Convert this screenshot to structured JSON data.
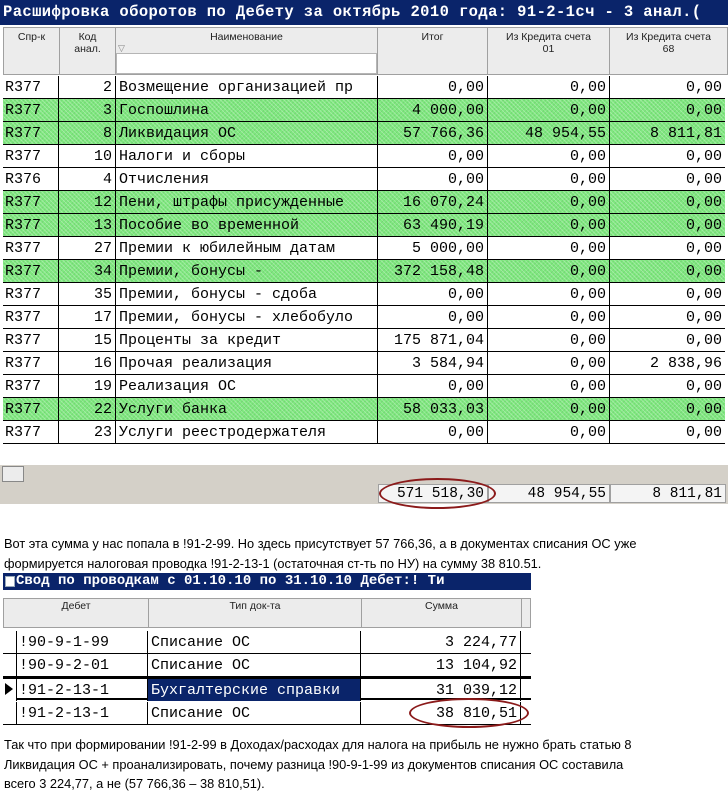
{
  "win1": {
    "title": "Расшифровка оборотов по Дебету за октябрь 2010 года: 91-2-1сч - 3 анал.(",
    "columns": [
      "Спр-к",
      "Код\nанал.",
      "Наименование",
      "Итог",
      "Из Кредита счета\n01",
      "Из Кредита счета\n68"
    ],
    "rows": [
      {
        "sprk": "R377",
        "code": "2",
        "name": "Возмещение организацией пр",
        "total": "0,00",
        "cr01": "0,00",
        "cr68": "0,00",
        "green": false
      },
      {
        "sprk": "R377",
        "code": "3",
        "name": "Госпошлина",
        "total": "4 000,00",
        "cr01": "0,00",
        "cr68": "0,00",
        "green": true
      },
      {
        "sprk": "R377",
        "code": "8",
        "name": "Ликвидация ОС",
        "total": "57 766,36",
        "cr01": "48 954,55",
        "cr68": "8 811,81",
        "green": true
      },
      {
        "sprk": "R377",
        "code": "10",
        "name": "Налоги и сборы",
        "total": "0,00",
        "cr01": "0,00",
        "cr68": "0,00",
        "green": false
      },
      {
        "sprk": "R376",
        "code": "4",
        "name": "Отчисления",
        "total": "0,00",
        "cr01": "0,00",
        "cr68": "0,00",
        "green": false
      },
      {
        "sprk": "R377",
        "code": "12",
        "name": "Пени, штрафы присужденные",
        "total": "16 070,24",
        "cr01": "0,00",
        "cr68": "0,00",
        "green": true
      },
      {
        "sprk": "R377",
        "code": "13",
        "name": "Пособие во временной",
        "total": "63 490,19",
        "cr01": "0,00",
        "cr68": "0,00",
        "green": true
      },
      {
        "sprk": "R377",
        "code": "27",
        "name": "Премии к юбилейным датам",
        "total": "5 000,00",
        "cr01": "0,00",
        "cr68": "0,00",
        "green": false
      },
      {
        "sprk": "R377",
        "code": "34",
        "name": "Премии, бонусы -",
        "total": "372 158,48",
        "cr01": "0,00",
        "cr68": "0,00",
        "green": true
      },
      {
        "sprk": "R377",
        "code": "35",
        "name": "Премии, бонусы - сдоба",
        "total": "0,00",
        "cr01": "0,00",
        "cr68": "0,00",
        "green": false
      },
      {
        "sprk": "R377",
        "code": "17",
        "name": "Премии, бонусы - хлебобуло",
        "total": "0,00",
        "cr01": "0,00",
        "cr68": "0,00",
        "green": false
      },
      {
        "sprk": "R377",
        "code": "15",
        "name": "Проценты за кредит",
        "total": "175 871,04",
        "cr01": "0,00",
        "cr68": "0,00",
        "green": false
      },
      {
        "sprk": "R377",
        "code": "16",
        "name": "Прочая реализация",
        "total": "3 584,94",
        "cr01": "0,00",
        "cr68": "2 838,96",
        "green": false
      },
      {
        "sprk": "R377",
        "code": "19",
        "name": "Реализация ОС",
        "total": "0,00",
        "cr01": "0,00",
        "cr68": "0,00",
        "green": false
      },
      {
        "sprk": "R377",
        "code": "22",
        "name": "Услуги банка",
        "total": "58 033,03",
        "cr01": "0,00",
        "cr68": "0,00",
        "green": true
      },
      {
        "sprk": "R377",
        "code": "23",
        "name": "Услуги реестродержателя",
        "total": "0,00",
        "cr01": "0,00",
        "cr68": "0,00",
        "green": false
      }
    ],
    "footer": {
      "total": "571 518,30",
      "cr01": "48 954,55",
      "cr68": "8 811,81"
    }
  },
  "text1": {
    "line1": "Вот эта сумма у нас попала в !91-2-99. Но здесь присутствует 57 766,36, а в документах списания ОС уже",
    "line2": "формируется налоговая проводка !91-2-13-1 (остаточная ст-ть по НУ) на сумму 38 810.51."
  },
  "win2": {
    "title": "Свод по проводкам с 01.10.10 по 31.10.10 Дебет:! Ти",
    "columns": [
      "Дебет",
      "Тип док-та",
      "Сумма"
    ],
    "rows": [
      {
        "debit": "!90-9-1-99",
        "doctype": "Списание ОС",
        "sum": "3 224,77",
        "selected": false
      },
      {
        "debit": "!90-9-2-01",
        "doctype": "Списание ОС",
        "sum": "13 104,92",
        "selected": false
      },
      {
        "debit": "!91-2-13-1",
        "doctype": "Бухгалтерские справки",
        "sum": "31 039,12",
        "selected": true
      },
      {
        "debit": "!91-2-13-1",
        "doctype": "Списание ОС",
        "sum": "38 810,51",
        "selected": false
      }
    ]
  },
  "text2": {
    "line1": "Так что при формировании !91-2-99 в Доходах/расходах для налога на прибыль не нужно брать статью 8",
    "line2": "Ликвидация ОС + проанализировать, почему разница !90-9-1-99 из документов списания ОС составила",
    "line3": "всего 3 224,77, а не (57 766,36 – 38 810,51)."
  },
  "colors": {
    "titlebar": "#0a246a",
    "green_row": "#7ee87e",
    "oval": "#8b1a1a"
  },
  "icons": {
    "filter": "filter-triangle-icon",
    "record": "record-pointer-icon",
    "window": "window-icon"
  }
}
